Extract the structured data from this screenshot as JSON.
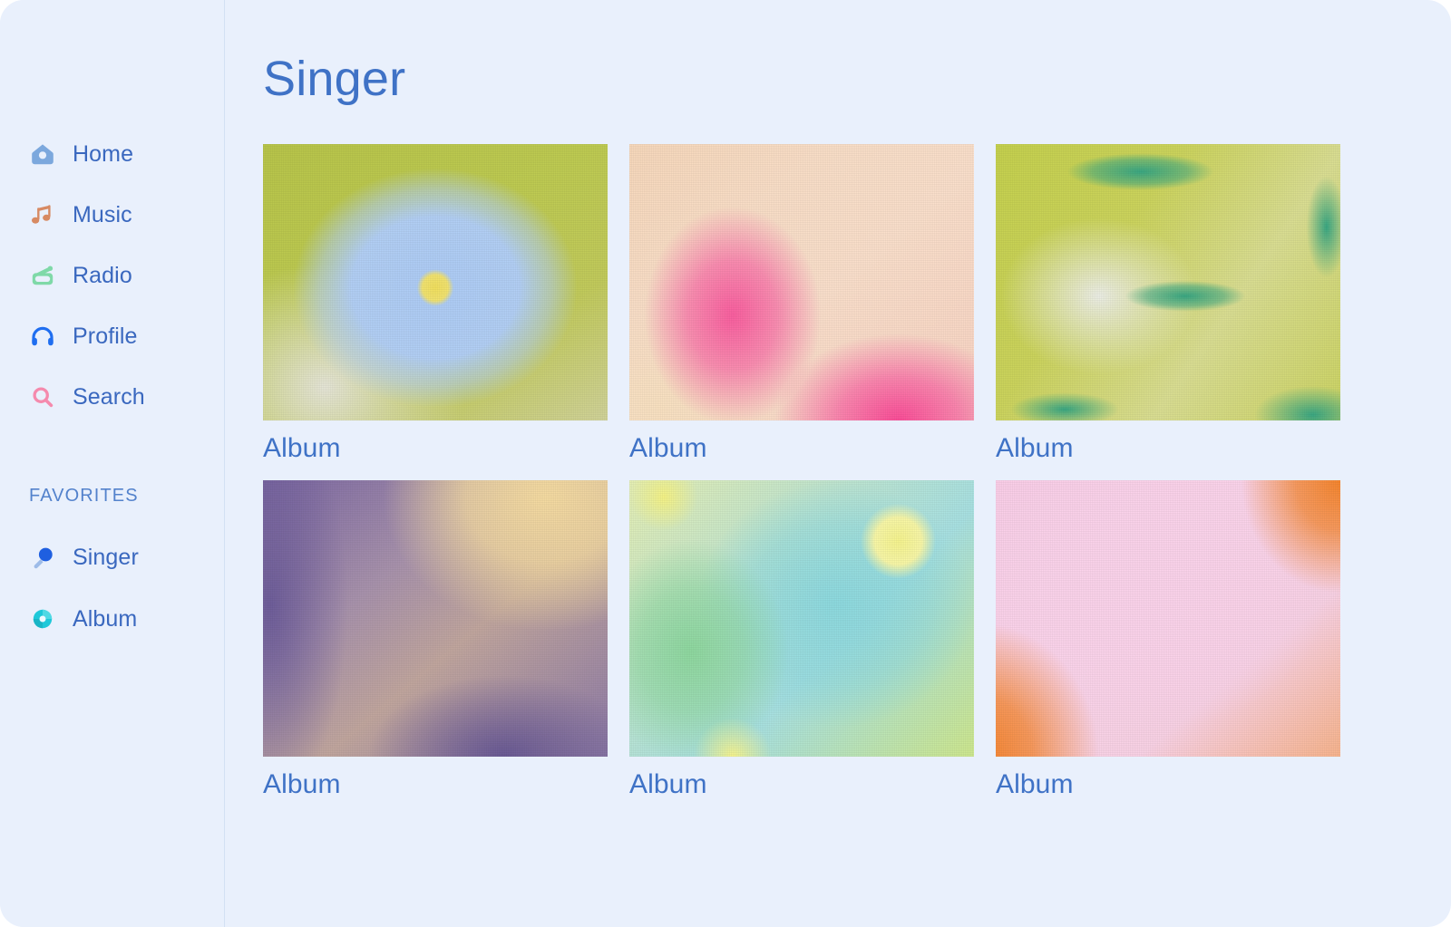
{
  "sidebar": {
    "nav_items": [
      {
        "label": "Home",
        "icon": "house-icon",
        "color": "#7ca8dd"
      },
      {
        "label": "Music",
        "icon": "music-note-icon",
        "color": "#d78a63"
      },
      {
        "label": "Radio",
        "icon": "radio-icon",
        "color": "#7fd9a8"
      },
      {
        "label": "Profile",
        "icon": "headphones-icon",
        "color": "#1f6ef0"
      },
      {
        "label": "Search",
        "icon": "search-icon",
        "color": "#f58aad"
      }
    ],
    "favorites_heading": "FAVORITES",
    "favorites": [
      {
        "label": "Singer",
        "icon": "microphone-icon",
        "color": "#1f5fe0"
      },
      {
        "label": "Album",
        "icon": "vinyl-record-icon",
        "color": "#1ec8d9"
      }
    ]
  },
  "main": {
    "page_title": "Singer",
    "albums": [
      {
        "label": "Album",
        "art": "art1",
        "art_name": "blue-diamond-yellow-sun-gradient"
      },
      {
        "label": "Album",
        "art": "art2",
        "art_name": "peach-pink-gradient"
      },
      {
        "label": "Album",
        "art": "art3",
        "art_name": "lime-teal-blobs-gradient"
      },
      {
        "label": "Album",
        "art": "art4",
        "art_name": "purple-gold-gradient"
      },
      {
        "label": "Album",
        "art": "art5",
        "art_name": "aqua-yellow-sun-gradient"
      },
      {
        "label": "Album",
        "art": "art6",
        "art_name": "pink-orange-gradient"
      }
    ]
  },
  "colors": {
    "page_background": "#e9f0fc",
    "text_blue": "#3f72c6",
    "divider": "#d3e0f3"
  }
}
